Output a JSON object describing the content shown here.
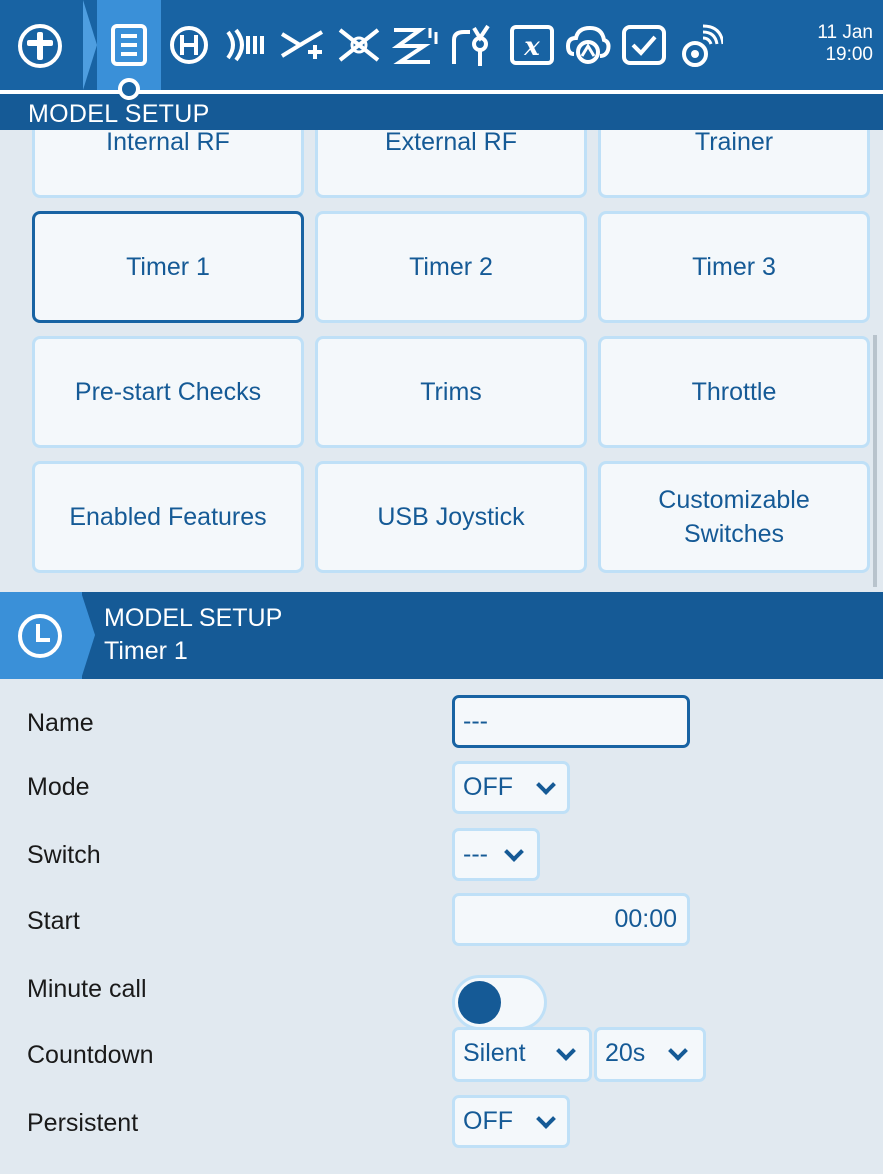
{
  "topbar": {
    "date": "11 Jan",
    "time": "19:00",
    "icons": [
      "home-icon",
      "model-setup-icon",
      "heli-icon",
      "inputs-icon",
      "mixes-icon",
      "outputs-icon",
      "curves-icon",
      "logical-switches-icon",
      "global-variables-icon",
      "special-functions-icon",
      "checklist-icon",
      "telemetry-icon"
    ]
  },
  "section": {
    "title": "MODEL SETUP"
  },
  "grid": {
    "buttons": [
      "Internal RF",
      "External RF",
      "Trainer",
      "Timer 1",
      "Timer 2",
      "Timer 3",
      "Pre-start Checks",
      "Trims",
      "Throttle",
      "Enabled Features",
      "USB Joystick",
      "Customizable Switches"
    ],
    "focused": "Timer 1"
  },
  "page": {
    "title": "MODEL SETUP",
    "subtitle": "Timer 1"
  },
  "form": {
    "name_label": "Name",
    "name_value": "---",
    "mode_label": "Mode",
    "mode_value": "OFF",
    "switch_label": "Switch",
    "switch_value": "---",
    "start_label": "Start",
    "start_value": "00:00",
    "minute_call_label": "Minute call",
    "minute_call_on": false,
    "countdown_label": "Countdown",
    "countdown_value": "Silent",
    "countdown_time": "20s",
    "persistent_label": "Persistent",
    "persistent_value": "OFF"
  },
  "colors": {
    "header": "#1863a3",
    "accent": "#3a90d8",
    "text_accent": "#155a96",
    "background": "#e1e9f0"
  }
}
